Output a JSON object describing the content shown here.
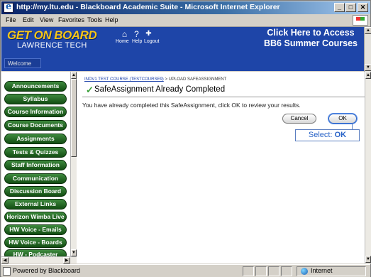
{
  "window": {
    "title": "http://my.ltu.edu - Blackboard Academic Suite - Microsoft Internet Explorer",
    "minimize": "_",
    "maximize": "□",
    "close": "✕"
  },
  "menu": [
    "File",
    "Edit",
    "View",
    "Favorites",
    "Tools",
    "Help"
  ],
  "header": {
    "logo_top": "GET ON BOARD",
    "logo_bottom": "LAWRENCE TECH",
    "links": {
      "home": "Home",
      "help": "Help",
      "logout": "Logout"
    },
    "promo": "Click Here to Access BB6 Summer Courses",
    "welcome_tab": "Welcome"
  },
  "sidebar": {
    "items": [
      "Announcements",
      "Syllabus",
      "Course Information",
      "Course Documents",
      "Assignments",
      "Tests & Quizzes",
      "Staff Information",
      "Communication",
      "Discussion Board",
      "External Links",
      "Horizon Wimba Live",
      "HW Voice - Emails",
      "HW Voice - Boards",
      "HW - Podcaster"
    ]
  },
  "content": {
    "breadcrumb": {
      "link": "INDV1 TEST COURSE (TESTCOURSE9)",
      "separator": " > ",
      "current": "UPLOAD SAFEASSIGNMENT"
    },
    "heading": "SafeAssignment Already Completed",
    "message": "You have already completed this SafeAssignment, click OK to review your results.",
    "cancel_label": "Cancel",
    "ok_label": "OK",
    "callout_prefix": "Select: ",
    "callout_emphasis": "OK"
  },
  "statusbar": {
    "text": "Powered by Blackboard",
    "zone": "Internet"
  },
  "colors": {
    "header_bg": "#1e45a8",
    "logo_yellow": "#f5c518",
    "nav_green": "#2a6e2a",
    "callout_blue": "#2a64c8"
  },
  "icons": {
    "home": "home-icon",
    "help": "help-icon",
    "logout": "logout-icon",
    "check": "checkmark-icon"
  }
}
